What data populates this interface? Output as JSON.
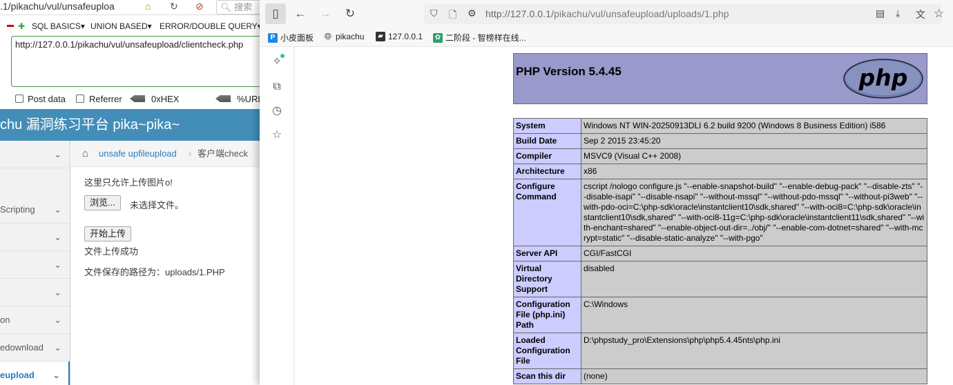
{
  "left_window": {
    "url_fragment": ".1/pikachu/vul/unsafeuploa",
    "search_placeholder": "搜索",
    "hackbar_menus": [
      "SQL BASICS▾",
      "UNION BASED▾",
      "ERROR/DOUBLE QUERY▾"
    ],
    "hackbar_url": "http://127.0.0.1/pikachu/vul/unsafeupload/clientcheck.php",
    "post_data_label": "Post data",
    "referrer_label": "Referrer",
    "hex_label": "0xHEX",
    "url_label": "%URL",
    "site_title": "chu 漏洞练习平台 pika~pika~",
    "sidebar_items": [
      {
        "label": ""
      },
      {
        "label": "Scripting"
      },
      {
        "label": ""
      },
      {
        "label": ""
      },
      {
        "label": ""
      },
      {
        "label": "on"
      },
      {
        "label": "edownload"
      },
      {
        "label": "eupload"
      }
    ],
    "breadcrumb": {
      "link": "unsafe upfileupload",
      "sep": "›",
      "current": "客户端check"
    },
    "content": {
      "intro": "这里只允许上传图片o!",
      "browse_button": "浏览...",
      "no_file": "未选择文件。",
      "upload_button": "开始上传",
      "success": "文件上传成功",
      "saved_path": "文件保存的路径为：uploads/1.PHP"
    }
  },
  "right_window": {
    "url_prefix": "http://127.0.0.1/",
    "url_rest": "pikachu/vul/unsafeupload/uploads/1.php",
    "bookmarks": [
      {
        "label": "小皮面板",
        "icon": "P"
      },
      {
        "label": "pikachu",
        "icon": "globe"
      },
      {
        "label": "127.0.0.1",
        "icon": "folder"
      },
      {
        "label": "二阶段 - 智榜样在线...",
        "icon": "leaf"
      }
    ]
  },
  "phpinfo": {
    "title": "PHP Version 5.4.45",
    "logo_text": "php",
    "rows": [
      {
        "key": "System",
        "value": "Windows NT WIN-20250913DLI 6.2 build 9200 (Windows 8 Business Edition) i586"
      },
      {
        "key": "Build Date",
        "value": "Sep 2 2015 23:45:20"
      },
      {
        "key": "Compiler",
        "value": "MSVC9 (Visual C++ 2008)"
      },
      {
        "key": "Architecture",
        "value": "x86"
      },
      {
        "key": "Configure Command",
        "value": "cscript /nologo configure.js \"--enable-snapshot-build\" \"--enable-debug-pack\" \"--disable-zts\" \"--disable-isapi\" \"--disable-nsapi\" \"--without-mssql\" \"--without-pdo-mssql\" \"--without-pi3web\" \"--with-pdo-oci=C:\\php-sdk\\oracle\\instantclient10\\sdk,shared\" \"--with-oci8=C:\\php-sdk\\oracle\\instantclient10\\sdk,shared\" \"--with-oci8-11g=C:\\php-sdk\\oracle\\instantclient11\\sdk,shared\" \"--with-enchant=shared\" \"--enable-object-out-dir=../obj/\" \"--enable-com-dotnet=shared\" \"--with-mcrypt=static\" \"--disable-static-analyze\" \"--with-pgo\""
      },
      {
        "key": "Server API",
        "value": "CGI/FastCGI"
      },
      {
        "key": "Virtual Directory Support",
        "value": "disabled"
      },
      {
        "key": "Configuration File (php.ini) Path",
        "value": "C:\\Windows"
      },
      {
        "key": "Loaded Configuration File",
        "value": "D:\\phpstudy_pro\\Extensions\\php\\php5.4.45nts\\php.ini"
      },
      {
        "key": "Scan this dir",
        "value": "(none)"
      }
    ]
  }
}
